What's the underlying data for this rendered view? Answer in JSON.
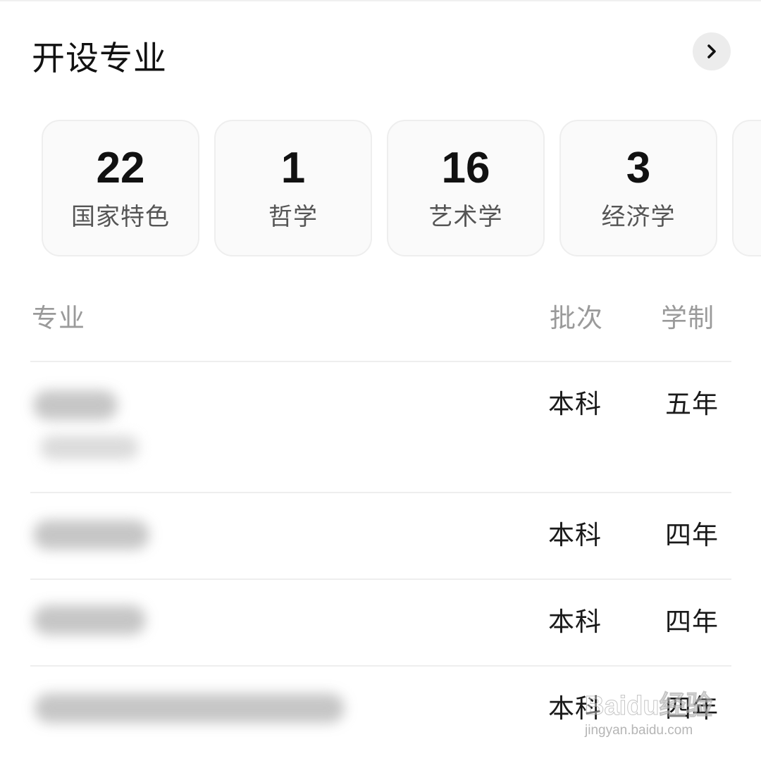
{
  "header": {
    "title": "开设专业",
    "more_icon": "chevron-right-icon"
  },
  "categories": [
    {
      "count": "22",
      "label": "国家特色"
    },
    {
      "count": "1",
      "label": "哲学"
    },
    {
      "count": "16",
      "label": "艺术学"
    },
    {
      "count": "3",
      "label": "经济学"
    }
  ],
  "table": {
    "columns": {
      "major": "专业",
      "batch": "批次",
      "years": "学制"
    },
    "rows": [
      {
        "batch": "本科",
        "years": "五年"
      },
      {
        "batch": "本科",
        "years": "四年"
      },
      {
        "batch": "本科",
        "years": "四年"
      },
      {
        "batch": "本科",
        "years": "四年"
      }
    ]
  },
  "watermark": {
    "brand": "Baidu经验",
    "url": "jingyan.baidu.com"
  }
}
